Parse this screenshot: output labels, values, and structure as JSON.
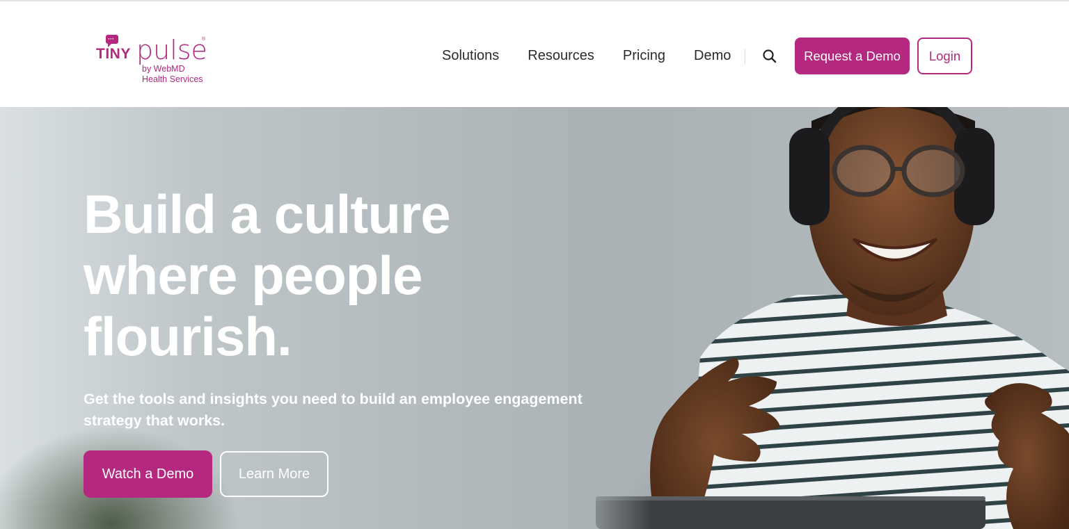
{
  "brand": {
    "logo_tiny": "TINY",
    "logo_pulse": "pulse",
    "logo_by": "by WebMD",
    "logo_health": "Health Services",
    "logo_reg": "®",
    "accent_color": "#b4287f"
  },
  "nav": {
    "items": [
      {
        "label": "Solutions"
      },
      {
        "label": "Resources"
      },
      {
        "label": "Pricing"
      },
      {
        "label": "Demo"
      }
    ],
    "search_icon": "search-icon",
    "request_demo_label": "Request a Demo",
    "login_label": "Login"
  },
  "hero": {
    "title_lines": [
      "Build a culture",
      "where people",
      "flourish."
    ],
    "subtitle": "Get the tools and insights you need to build an employee engagement strategy that works.",
    "primary_cta": "Watch a Demo",
    "secondary_cta": "Learn More",
    "image": "smiling-man-with-headphones-photo"
  }
}
